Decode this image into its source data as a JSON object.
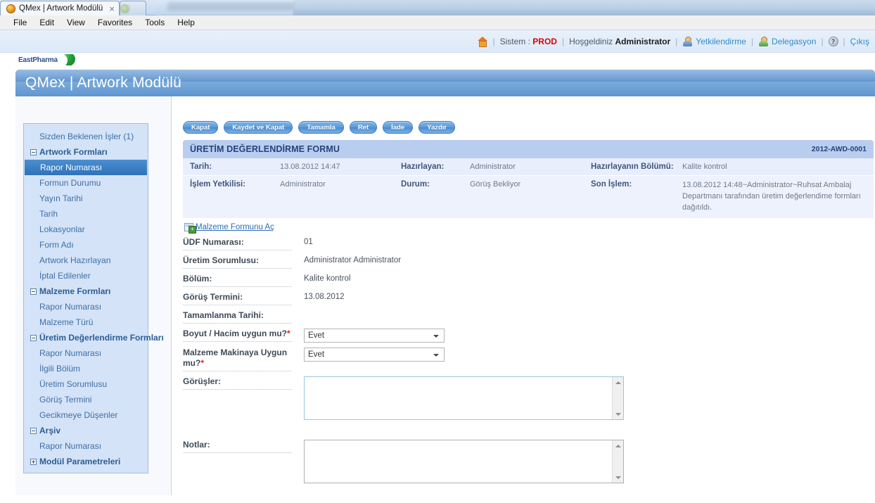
{
  "browser": {
    "tabs": [
      {
        "title": "QMex | Artwork Modülü",
        "active": true,
        "close_label": "×"
      },
      {
        "title": "",
        "active": false,
        "close_label": ""
      }
    ],
    "menu": [
      "File",
      "Edit",
      "View",
      "Favorites",
      "Tools",
      "Help"
    ]
  },
  "utility": {
    "home_icon": "home-icon",
    "system_label": "Sistem :",
    "system_value": "PROD",
    "greeting_label": "Hoşgeldiniz",
    "greeting_user": "Administrator",
    "authorize_link": "Yetkilendirme",
    "delegation_link": "Delegasyon",
    "help_icon": "?",
    "logout_link": "Çıkış",
    "separator": "|"
  },
  "brand": {
    "name": "EastPharma",
    "logo_icon": "swoosh-logo-icon"
  },
  "header": {
    "page_title": "QMex | Artwork Modülü"
  },
  "sidebar": {
    "items": [
      {
        "label": "Sizden Beklenen İşler (1)",
        "type": "leaf",
        "selected": false
      },
      {
        "label": "Artwork Formları",
        "type": "group",
        "expanded": true
      },
      {
        "label": "Rapor Numarası",
        "type": "leaf",
        "selected": true
      },
      {
        "label": "Formun Durumu",
        "type": "leaf",
        "selected": false
      },
      {
        "label": "Yayın Tarihi",
        "type": "leaf",
        "selected": false
      },
      {
        "label": "Tarih",
        "type": "leaf",
        "selected": false
      },
      {
        "label": "Lokasyonlar",
        "type": "leaf",
        "selected": false
      },
      {
        "label": "Form Adı",
        "type": "leaf",
        "selected": false
      },
      {
        "label": "Artwork Hazırlayan",
        "type": "leaf",
        "selected": false
      },
      {
        "label": "İptal Edilenler",
        "type": "leaf",
        "selected": false
      },
      {
        "label": "Malzeme Formları",
        "type": "group",
        "expanded": true
      },
      {
        "label": "Rapor Numarası",
        "type": "leaf",
        "selected": false
      },
      {
        "label": "Malzeme Türü",
        "type": "leaf",
        "selected": false
      },
      {
        "label": "Üretim Değerlendirme Formları",
        "type": "group",
        "expanded": true
      },
      {
        "label": "Rapor Numarası",
        "type": "leaf",
        "selected": false
      },
      {
        "label": "İlgili Bölüm",
        "type": "leaf",
        "selected": false
      },
      {
        "label": "Üretim Sorumlusu",
        "type": "leaf",
        "selected": false
      },
      {
        "label": "Görüş Termini",
        "type": "leaf",
        "selected": false
      },
      {
        "label": "Gecikmeye Düşenler",
        "type": "leaf",
        "selected": false
      },
      {
        "label": "Arşiv",
        "type": "group",
        "expanded": true
      },
      {
        "label": "Rapor Numarası",
        "type": "leaf",
        "selected": false
      },
      {
        "label": "Modül Parametreleri",
        "type": "group",
        "expanded": false
      }
    ]
  },
  "toolbar": {
    "buttons": [
      {
        "label": "Kapat"
      },
      {
        "label": "Kaydet ve Kapat"
      },
      {
        "label": "Tamamla"
      },
      {
        "label": "Ret"
      },
      {
        "label": "İade"
      },
      {
        "label": "Yazdır"
      }
    ]
  },
  "form_card": {
    "title": "ÜRETİM DEĞERLENDİRME FORMU",
    "code": "2012-AWD-0001",
    "rows": [
      {
        "c1_label": "Tarih:",
        "c1_value": "13.08.2012 14:47",
        "c2_label": "Hazırlayan:",
        "c2_value": "Administrator",
        "c3_label": "Hazırlayanın Bölümü:",
        "c3_value": "Kalite kontrol"
      },
      {
        "c1_label": "İşlem Yetkilisi:",
        "c1_value": "Administrator",
        "c2_label": "Durum:",
        "c2_value": "Görüş Bekliyor",
        "c3_label": "Son İşlem:",
        "c3_value": "13.08.2012 14:48~Administrator~Ruhsat Ambalaj Departmanı tarafından üretim değerlendime formları dağıtıldı."
      }
    ]
  },
  "open_material_form_link": {
    "label": "Malzeme Formunu Aç",
    "icon": "form-add-icon"
  },
  "fields": [
    {
      "label": "ÜDF Numarası:",
      "value": "01",
      "kind": "text"
    },
    {
      "label": "Üretim Sorumlusu:",
      "value": "Administrator Administrator",
      "kind": "text"
    },
    {
      "label": "Bölüm:",
      "value": "Kalite kontrol",
      "kind": "text"
    },
    {
      "label": "Görüş Termini:",
      "value": "13.08.2012",
      "kind": "text"
    },
    {
      "label": "Tamamlanma Tarihi:",
      "value": "",
      "kind": "text"
    },
    {
      "label": "Boyut / Hacim uygun mu?",
      "required": true,
      "value": "Evet",
      "kind": "select"
    },
    {
      "label": "Malzeme Makinaya Uygun mu?",
      "required": true,
      "value": "Evet",
      "kind": "select"
    },
    {
      "label": "Görüşler:",
      "value": "",
      "kind": "textarea"
    },
    {
      "label": "Notlar:",
      "value": "",
      "kind": "textarea"
    }
  ]
}
